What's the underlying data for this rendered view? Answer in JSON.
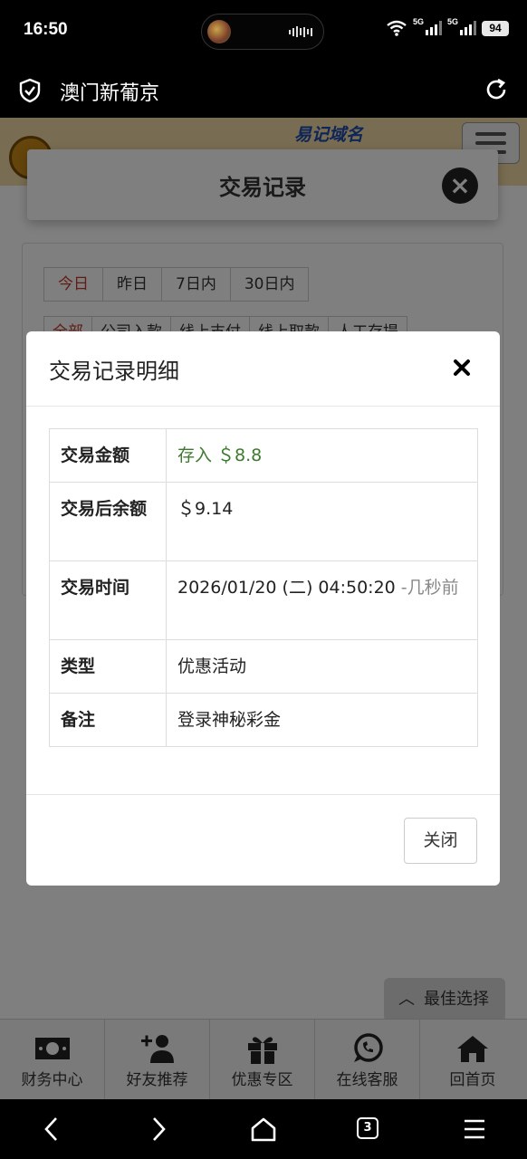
{
  "status": {
    "time": "16:50",
    "battery": "94",
    "network_1": "5G",
    "network_2": "5G"
  },
  "browser": {
    "title": "澳门新葡京"
  },
  "site": {
    "domain_text": "易记域名"
  },
  "panel": {
    "title": "交易记录",
    "date_filters": [
      "今日",
      "昨日",
      "7日内",
      "30日内"
    ],
    "type_filters": [
      "全部",
      "公司入款",
      "线上支付",
      "线上取款",
      "人工存提"
    ]
  },
  "modal": {
    "title": "交易记录明细",
    "rows": [
      {
        "label": "交易金额",
        "value": "存入 ＄8.8"
      },
      {
        "label": "交易后余额",
        "value": "＄9.14"
      },
      {
        "label": "交易时间",
        "value": "2026/01/20 (二) 04:50:20",
        "suffix": "-几秒前"
      },
      {
        "label": "类型",
        "value": "优惠活动"
      },
      {
        "label": "备注",
        "value": "登录神秘彩金"
      }
    ],
    "close_label": "关闭"
  },
  "best_choice": "最佳选择",
  "bottom_nav": [
    {
      "label": "财务中心",
      "icon": "money-icon"
    },
    {
      "label": "好友推荐",
      "icon": "add-user-icon"
    },
    {
      "label": "优惠专区",
      "icon": "gift-icon"
    },
    {
      "label": "在线客服",
      "icon": "chat-icon"
    },
    {
      "label": "回首页",
      "icon": "home-icon"
    }
  ],
  "tabs_count": "3"
}
